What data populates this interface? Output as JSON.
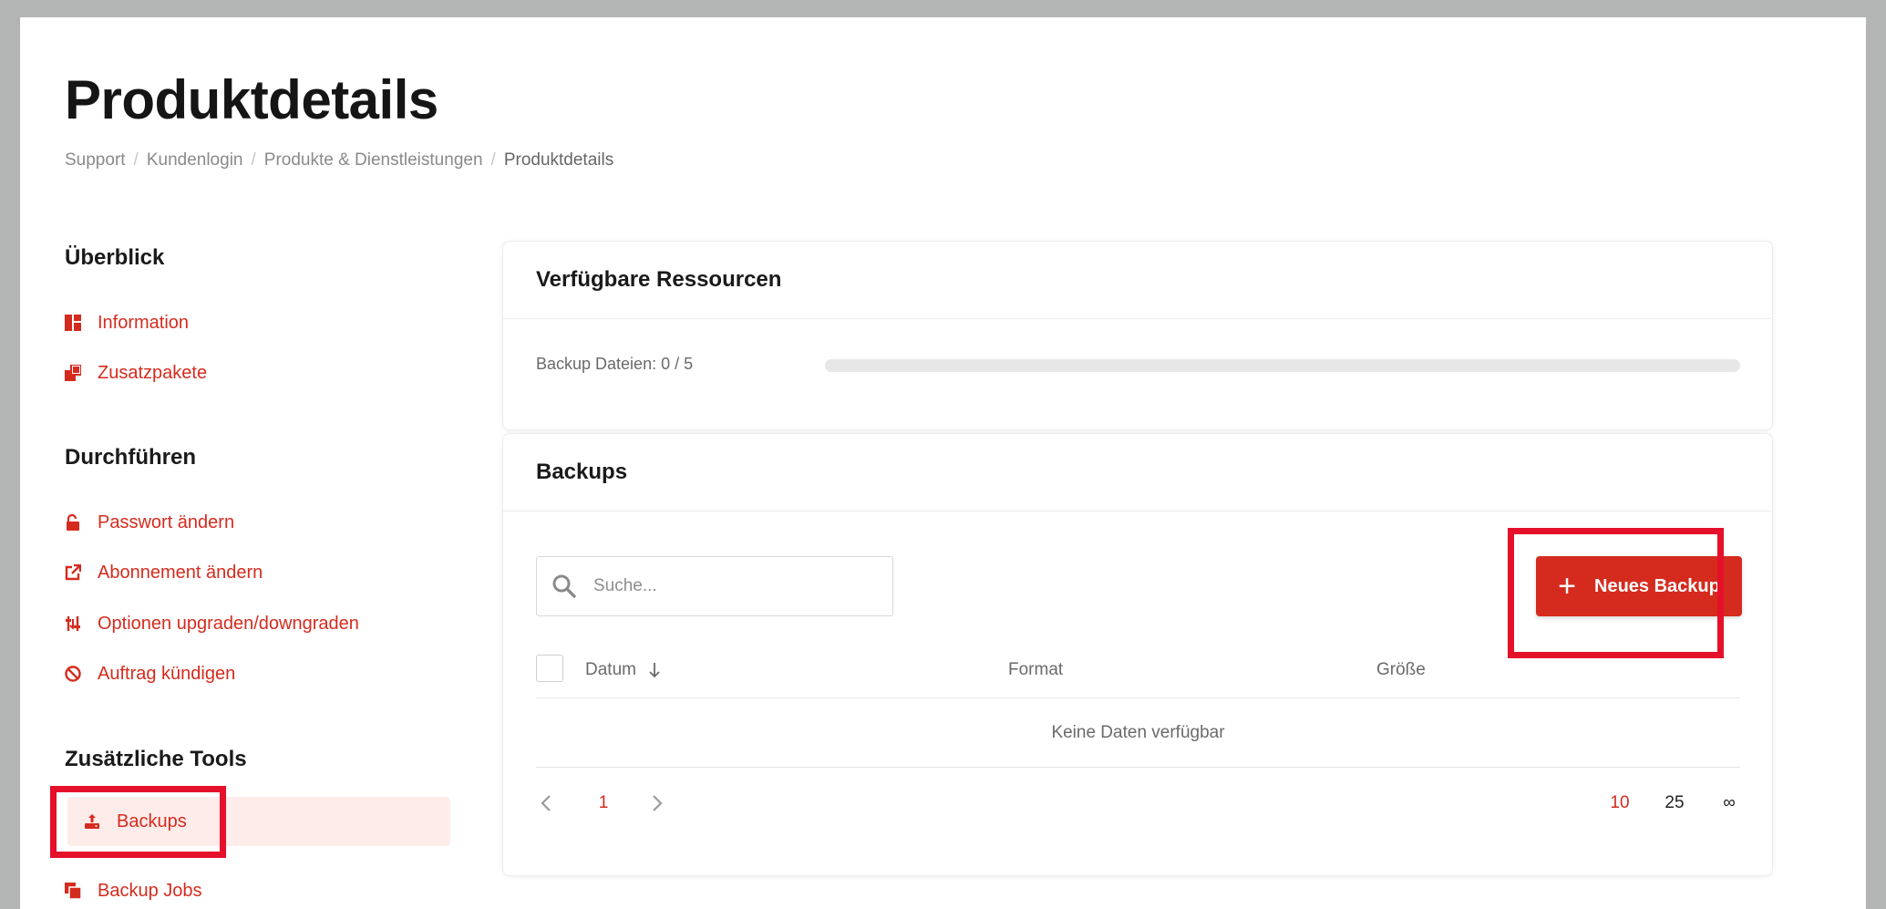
{
  "page": {
    "title": "Produktdetails",
    "breadcrumb": [
      "Support",
      "Kundenlogin",
      "Produkte & Dienstleistungen",
      "Produktdetails"
    ]
  },
  "sidebar": {
    "sections": [
      {
        "heading": "Überblick",
        "items": [
          {
            "label": "Information",
            "icon": "dashboard-icon"
          },
          {
            "label": "Zusatzpakete",
            "icon": "addons-icon"
          }
        ]
      },
      {
        "heading": "Durchführen",
        "items": [
          {
            "label": "Passwort ändern",
            "icon": "lock-open-icon"
          },
          {
            "label": "Abonnement ändern",
            "icon": "external-link-icon"
          },
          {
            "label": "Optionen upgraden/downgraden",
            "icon": "sliders-icon"
          },
          {
            "label": "Auftrag kündigen",
            "icon": "ban-icon"
          }
        ]
      },
      {
        "heading": "Zusätzliche Tools",
        "items": [
          {
            "label": "Backups",
            "icon": "backup-upload-icon",
            "active": true
          },
          {
            "label": "Backup Jobs",
            "icon": "copy-icon"
          }
        ]
      }
    ]
  },
  "resources": {
    "title": "Verfügbare Ressourcen",
    "backup_files_label": "Backup Dateien: 0 / 5",
    "backup_files_used": 0,
    "backup_files_total": 5
  },
  "backups": {
    "title": "Backups",
    "search_placeholder": "Suche...",
    "new_button": "Neues Backup",
    "columns": [
      "Datum",
      "Format",
      "Größe"
    ],
    "sort_column": "Datum",
    "sort_direction": "desc",
    "empty_text": "Keine Daten verfügbar",
    "pagination": {
      "current_page": "1",
      "page_sizes": [
        "10",
        "25",
        "∞"
      ],
      "selected_size": "10"
    }
  },
  "colors": {
    "accent": "#d52b1e",
    "active_bg": "#fdecea",
    "highlight": "#e5102a"
  }
}
